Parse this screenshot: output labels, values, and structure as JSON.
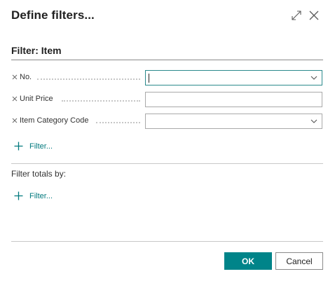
{
  "dialog": {
    "title": "Define filters...",
    "expand_icon": "expand-diagonal-icon",
    "close_icon": "close-icon"
  },
  "filter_section": {
    "title": "Filter: Item",
    "fields": [
      {
        "label": "No.",
        "value": "",
        "has_dropdown": true,
        "focused": true
      },
      {
        "label": "Unit Price",
        "value": "",
        "has_dropdown": false,
        "focused": false
      },
      {
        "label": "Item Category Code",
        "value": "",
        "has_dropdown": true,
        "focused": false
      }
    ],
    "add_filter_label": "Filter..."
  },
  "totals_section": {
    "title": "Filter totals by:",
    "add_filter_label": "Filter..."
  },
  "buttons": {
    "ok": "OK",
    "cancel": "Cancel"
  },
  "colors": {
    "accent": "#008489",
    "link": "#00797d",
    "focus_border": "#2b8a8c"
  }
}
